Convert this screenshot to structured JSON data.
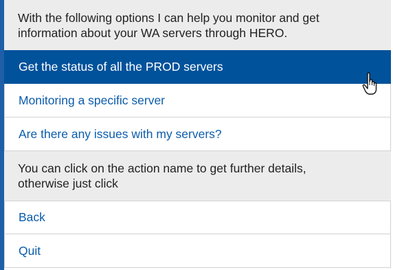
{
  "intro": {
    "line1": "With the following options I can help you monitor and get",
    "line2": "information about your WA servers through HERO."
  },
  "options": [
    {
      "label": "Get the status of all the PROD servers",
      "selected": true
    },
    {
      "label": "Monitoring a specific server",
      "selected": false
    },
    {
      "label": "Are there any issues with my servers?",
      "selected": false
    }
  ],
  "hint": {
    "line1": "You can click on the action name to get further details,",
    "line2": "otherwise just click"
  },
  "actions": [
    {
      "label": "Back"
    },
    {
      "label": "Quit"
    }
  ],
  "colors": {
    "accent": "#1f5fa8",
    "selected_bg": "#00529b",
    "link": "#0b5cab",
    "info_bg": "#ececec"
  },
  "icons": {
    "cursor": "hand-pointer-icon"
  }
}
